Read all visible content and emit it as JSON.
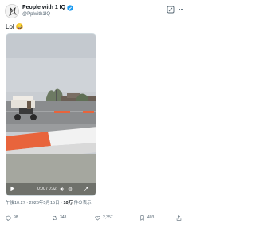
{
  "header": {
    "name": "People with 1 IQ",
    "handle": "@Pplwith1IQ",
    "more_label": "···"
  },
  "tweet": {
    "text": "Lol 😆"
  },
  "video": {
    "time": "0:00 / 0:32",
    "progress": 0
  },
  "meta": {
    "time": "午後10:27 · 2026年5月15日 · ",
    "views": "10万",
    "views_suffix": " 件の表示"
  },
  "actions": {
    "replies": "98",
    "reposts": "348",
    "likes": "2,357",
    "bookmarks": "403"
  },
  "colors": {
    "verified": "#1d9bf0",
    "text_secondary": "#536471",
    "barrier_orange": "#e8643c"
  }
}
